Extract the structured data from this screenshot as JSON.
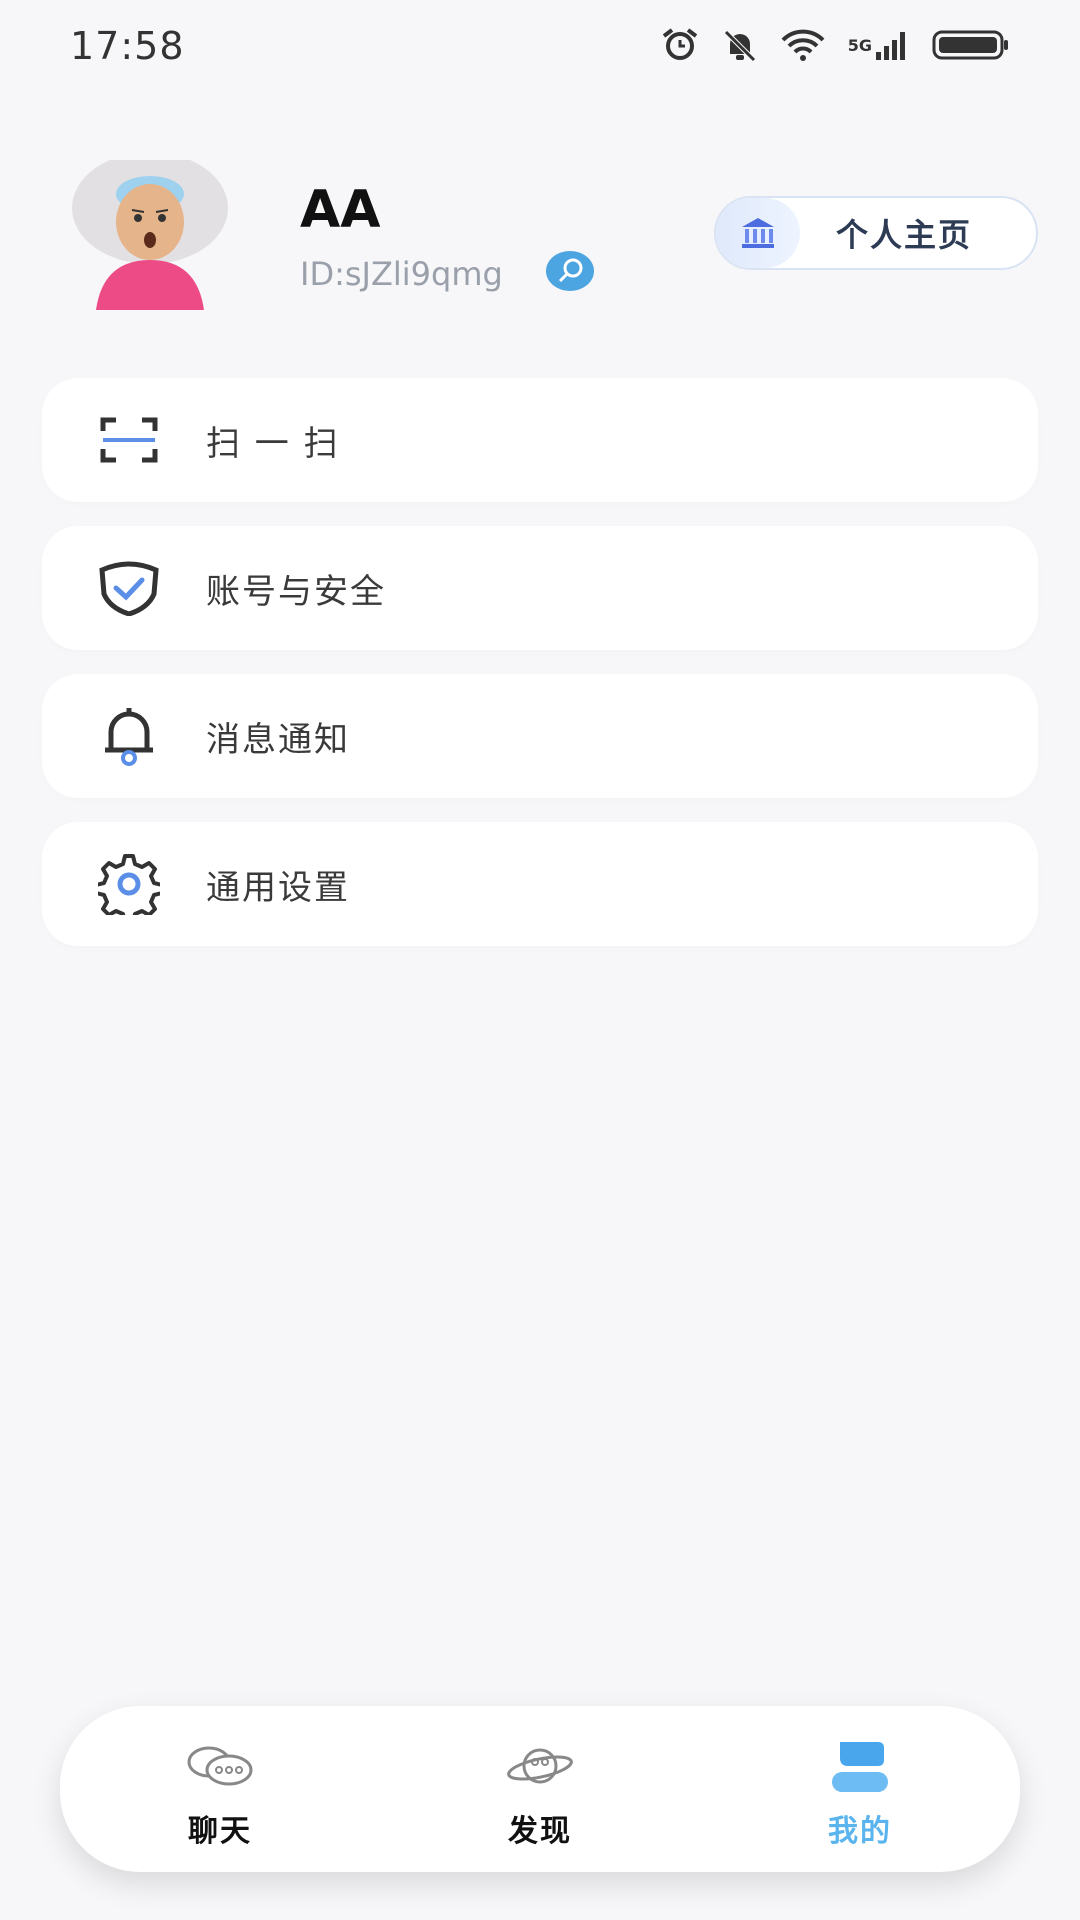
{
  "status_bar": {
    "time": "17:58",
    "network": "5G",
    "icons": [
      "alarm-icon",
      "mute-icon",
      "wifi-icon",
      "signal-icon",
      "battery-icon"
    ]
  },
  "profile": {
    "name": "AA",
    "id": "ID:sJZli9qmg",
    "homepage_button": "个人主页"
  },
  "menu": {
    "items": [
      {
        "label": "扫 一 扫",
        "icon": "scan-icon"
      },
      {
        "label": "账号与安全",
        "icon": "shield-check-icon"
      },
      {
        "label": "消息通知",
        "icon": "bell-icon"
      },
      {
        "label": "通用设置",
        "icon": "gear-icon"
      }
    ]
  },
  "tabbar": {
    "tabs": [
      {
        "label": "聊天",
        "icon": "chat-icon"
      },
      {
        "label": "发现",
        "icon": "planet-icon"
      },
      {
        "label": "我的",
        "icon": "user-icon",
        "active": true
      }
    ]
  },
  "colors": {
    "accent": "#5ab4ee",
    "background": "#f7f7f9",
    "active_tab": "#5ab4ee"
  }
}
